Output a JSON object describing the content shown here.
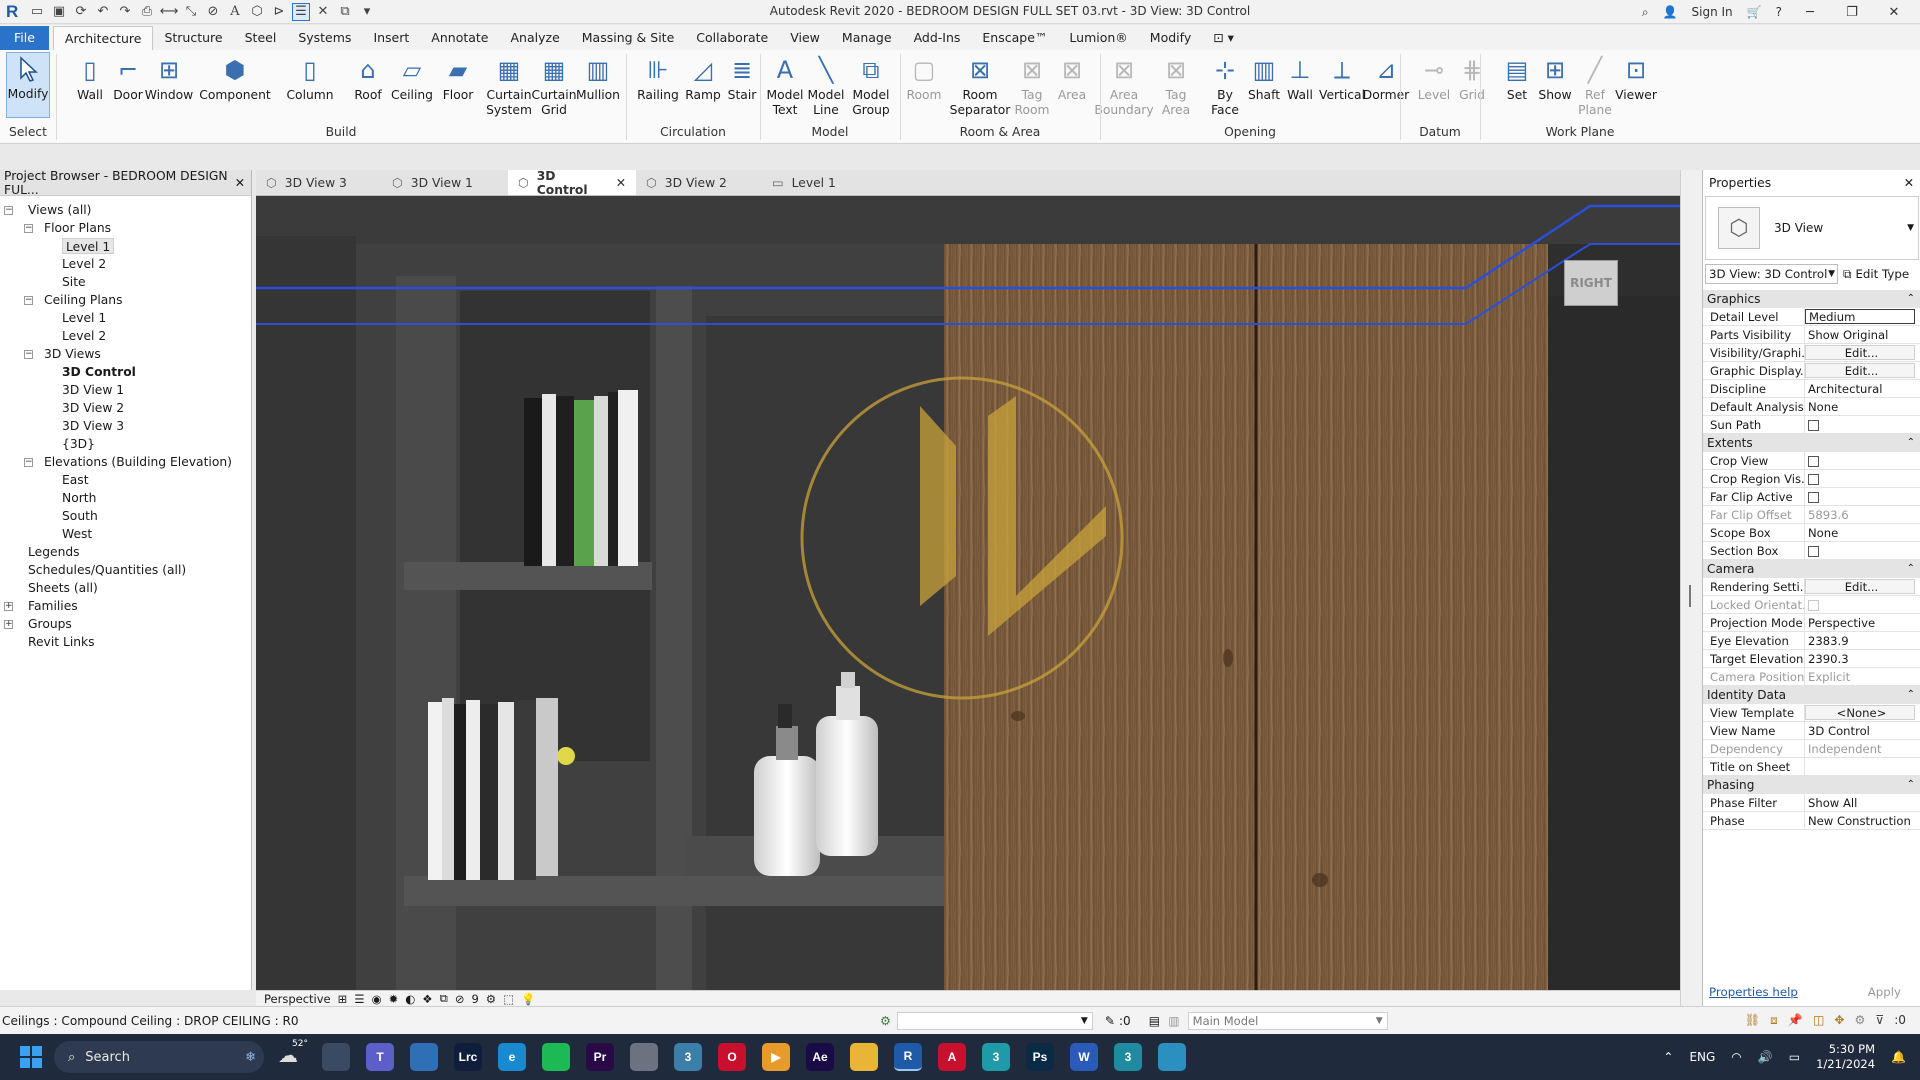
{
  "window": {
    "title": "Autodesk Revit 2020 - BEDROOM DESIGN FULL SET 03.rvt - 3D View: 3D Control",
    "sign_in": "Sign In"
  },
  "ribbon_tabs": [
    "File",
    "Architecture",
    "Structure",
    "Steel",
    "Systems",
    "Insert",
    "Annotate",
    "Analyze",
    "Massing & Site",
    "Collaborate",
    "View",
    "Manage",
    "Add-Ins",
    "Enscape™",
    "Lumion®",
    "Modify"
  ],
  "ribbon": {
    "tools": [
      "Modify",
      "Wall",
      "Door",
      "Window",
      "Component",
      "Column",
      "Roof",
      "Ceiling",
      "Floor",
      "Curtain System",
      "Curtain Grid",
      "Mullion",
      "Railing",
      "Ramp",
      "Stair",
      "Model Text",
      "Model Line",
      "Model Group",
      "Room",
      "Room Separator",
      "Tag Room",
      "Area",
      "Area Boundary",
      "Tag Area",
      "By Face",
      "Shaft",
      "Wall",
      "Vertical",
      "Dormer",
      "Level",
      "Grid",
      "Set",
      "Show",
      "Ref Plane",
      "Viewer"
    ],
    "groups": [
      "Select",
      "Build",
      "Circulation",
      "Model",
      "Room & Area",
      "Opening",
      "Datum",
      "Work Plane"
    ]
  },
  "view_tabs": [
    {
      "label": "3D View 3",
      "active": false
    },
    {
      "label": "3D View 1",
      "active": false
    },
    {
      "label": "3D Control",
      "active": true
    },
    {
      "label": "3D View 2",
      "active": false
    },
    {
      "label": "Level 1",
      "active": false
    }
  ],
  "project_browser": {
    "title": "Project Browser - BEDROOM DESIGN FUL...",
    "items": [
      {
        "label": "Views (all)",
        "level": 0
      },
      {
        "label": "Floor Plans",
        "level": 1
      },
      {
        "label": "Level 1",
        "level": 2,
        "selected": true
      },
      {
        "label": "Level 2",
        "level": 2
      },
      {
        "label": "Site",
        "level": 2
      },
      {
        "label": "Ceiling Plans",
        "level": 1
      },
      {
        "label": "Level 1",
        "level": 2
      },
      {
        "label": "Level 2",
        "level": 2
      },
      {
        "label": "3D Views",
        "level": 1
      },
      {
        "label": "3D Control",
        "level": 2,
        "bold": true
      },
      {
        "label": "3D View 1",
        "level": 2
      },
      {
        "label": "3D View 2",
        "level": 2
      },
      {
        "label": "3D View 3",
        "level": 2
      },
      {
        "label": "{3D}",
        "level": 2
      },
      {
        "label": "Elevations (Building Elevation)",
        "level": 1
      },
      {
        "label": "East",
        "level": 2
      },
      {
        "label": "North",
        "level": 2
      },
      {
        "label": "South",
        "level": 2
      },
      {
        "label": "West",
        "level": 2
      },
      {
        "label": "Legends",
        "level": 0
      },
      {
        "label": "Schedules/Quantities (all)",
        "level": 0
      },
      {
        "label": "Sheets (all)",
        "level": 0
      },
      {
        "label": "Families",
        "level": 0
      },
      {
        "label": "Groups",
        "level": 0
      },
      {
        "label": "Revit Links",
        "level": 0
      }
    ]
  },
  "viewport": {
    "viewcube_label": "RIGHT",
    "view_control_label": "Perspective",
    "scale_value": "9"
  },
  "properties": {
    "title": "Properties",
    "type_name": "3D View",
    "instance_selector": "3D View: 3D Control",
    "edit_type": "Edit Type",
    "sections": [
      {
        "name": "Graphics",
        "rows": [
          {
            "k": "Detail Level",
            "v": "Medium",
            "style": "box"
          },
          {
            "k": "Parts Visibility",
            "v": "Show Original"
          },
          {
            "k": "Visibility/Graphi...",
            "v": "Edit...",
            "style": "btn"
          },
          {
            "k": "Graphic Display...",
            "v": "Edit...",
            "style": "btn"
          },
          {
            "k": "Discipline",
            "v": "Architectural"
          },
          {
            "k": "Default Analysis...",
            "v": "None"
          },
          {
            "k": "Sun Path",
            "v": "",
            "style": "chk"
          }
        ]
      },
      {
        "name": "Extents",
        "rows": [
          {
            "k": "Crop View",
            "v": "",
            "style": "chk"
          },
          {
            "k": "Crop Region Vis...",
            "v": "",
            "style": "chk"
          },
          {
            "k": "Far Clip Active",
            "v": "",
            "style": "chk"
          },
          {
            "k": "Far Clip Offset",
            "v": "5893.6",
            "style": "grey"
          },
          {
            "k": "Scope Box",
            "v": "None"
          },
          {
            "k": "Section Box",
            "v": "",
            "style": "chk"
          }
        ]
      },
      {
        "name": "Camera",
        "rows": [
          {
            "k": "Rendering Setti...",
            "v": "Edit...",
            "style": "btn"
          },
          {
            "k": "Locked Orientat...",
            "v": "",
            "style": "greychk"
          },
          {
            "k": "Projection Mode",
            "v": "Perspective"
          },
          {
            "k": "Eye Elevation",
            "v": "2383.9"
          },
          {
            "k": "Target Elevation",
            "v": "2390.3"
          },
          {
            "k": "Camera Position",
            "v": "Explicit",
            "style": "grey"
          }
        ]
      },
      {
        "name": "Identity Data",
        "rows": [
          {
            "k": "View Template",
            "v": "<None>",
            "style": "btn"
          },
          {
            "k": "View Name",
            "v": "3D Control"
          },
          {
            "k": "Dependency",
            "v": "Independent",
            "style": "grey"
          },
          {
            "k": "Title on Sheet",
            "v": ""
          }
        ]
      },
      {
        "name": "Phasing",
        "rows": [
          {
            "k": "Phase Filter",
            "v": "Show All"
          },
          {
            "k": "Phase",
            "v": "New Construction"
          }
        ]
      }
    ],
    "help_link": "Properties help",
    "apply": "Apply"
  },
  "status_bar": {
    "message": "Ceilings : Compound Ceiling : DROP CEILING : R0",
    "selection_count": ":0",
    "model": "Main Model",
    "filter_count": ":0"
  },
  "taskbar": {
    "search": "Search",
    "weather": "52°",
    "language": "ENG",
    "time": "5:30 PM",
    "date": "1/21/2024",
    "apps": [
      {
        "name": "task-view",
        "label": "",
        "color": "#3a4a63"
      },
      {
        "name": "teams",
        "label": "T",
        "color": "#5b5fc7"
      },
      {
        "name": "photos",
        "label": "",
        "color": "#2f6fb5"
      },
      {
        "name": "lightroom-classic",
        "label": "Lrc",
        "color": "#0f1e3a"
      },
      {
        "name": "edge",
        "label": "e",
        "color": "#1a8ad0"
      },
      {
        "name": "spotify",
        "label": "",
        "color": "#1db954"
      },
      {
        "name": "premiere",
        "label": "Pr",
        "color": "#2a0a46"
      },
      {
        "name": "app-grey",
        "label": "",
        "color": "#6b7280"
      },
      {
        "name": "app-3ds",
        "label": "3",
        "color": "#3b7fa8"
      },
      {
        "name": "opera",
        "label": "O",
        "color": "#c8102e"
      },
      {
        "name": "media",
        "label": "▶",
        "color": "#e89a2a"
      },
      {
        "name": "after-effects",
        "label": "Ae",
        "color": "#1a0a46"
      },
      {
        "name": "file-explorer",
        "label": "",
        "color": "#e8b536"
      },
      {
        "name": "revit",
        "label": "R",
        "color": "#1f5aa8"
      },
      {
        "name": "autocad",
        "label": "A",
        "color": "#c8102e"
      },
      {
        "name": "app-3",
        "label": "3",
        "color": "#1f9aa8"
      },
      {
        "name": "photoshop",
        "label": "Ps",
        "color": "#0b2a46"
      },
      {
        "name": "word",
        "label": "W",
        "color": "#2b5bb8"
      },
      {
        "name": "app-3b",
        "label": "3",
        "color": "#1f8aa0"
      },
      {
        "name": "app-globe",
        "label": "",
        "color": "#2b8fbf"
      }
    ]
  },
  "colors": {
    "accent": "#2a73c9",
    "viewport_bg": "#2c2c2c",
    "wood": "#7a5a3a",
    "highlight": "#2b4fd8"
  }
}
